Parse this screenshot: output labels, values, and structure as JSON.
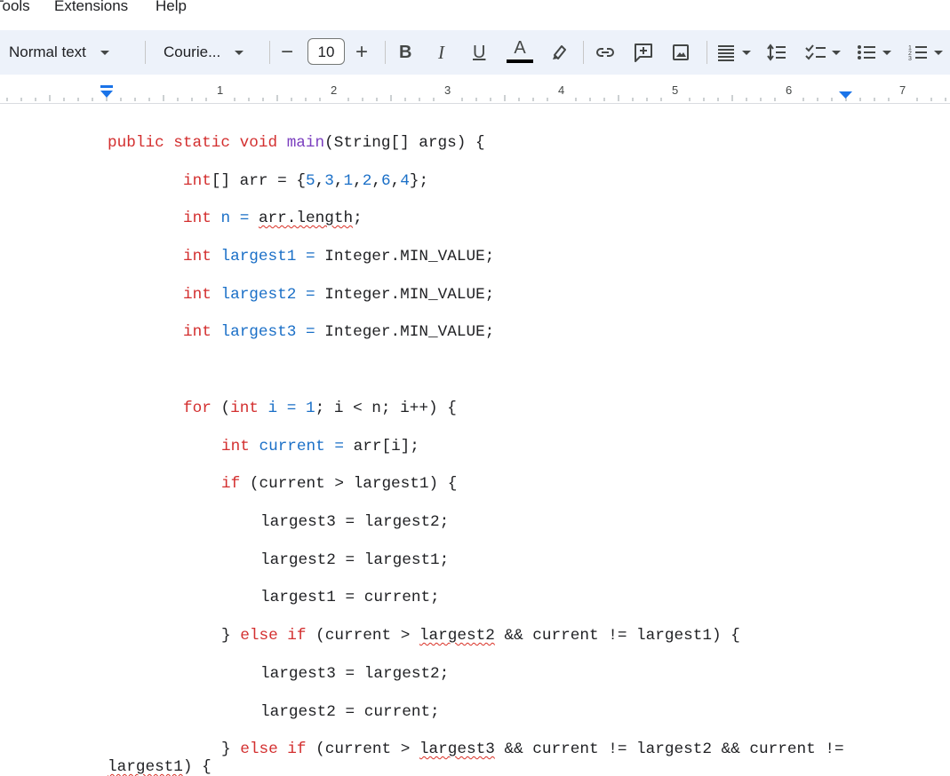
{
  "menu": {
    "tools": "Tools",
    "extensions": "Extensions",
    "help": "Help"
  },
  "toolbar": {
    "style_value": "Normal text",
    "font_value": "Courie...",
    "font_size": "10",
    "decrease_label": "−",
    "increase_label": "+",
    "bold_label": "B",
    "italic_label": "I",
    "underline_label": "U",
    "text_color_label": "A",
    "text_color": "#000000",
    "accent_color": "#1a73e8"
  },
  "ruler": {
    "numbers": [
      "1",
      "2",
      "3",
      "4",
      "5",
      "6",
      "7"
    ]
  },
  "code": {
    "line1": {
      "kw": "public static void",
      "sp1": " ",
      "fn": "main",
      "rest": "(String[] args) {"
    },
    "line2": {
      "kw": "int",
      "t1": "[] arr = {",
      "n1": "5",
      "c1": ",",
      "n2": "3",
      "c2": ",",
      "n3": "1",
      "c3": ",",
      "n4": "2",
      "c4": ",",
      "n5": "6",
      "c5": ",",
      "n6": "4",
      "t2": "};"
    },
    "line3": {
      "kw": "int",
      "sp": " ",
      "var": "n =",
      "sp2": " ",
      "squig": "arr.length",
      "rest": ";"
    },
    "line4": {
      "kw": "int",
      "sp": " ",
      "var": "largest1 =",
      "rest": " Integer.MIN_VALUE;"
    },
    "line5": {
      "kw": "int",
      "sp": " ",
      "var": "largest2 =",
      "rest": " Integer.MIN_VALUE;"
    },
    "line6": {
      "kw": "int",
      "sp": " ",
      "var": "largest3 =",
      "rest": " Integer.MIN_VALUE;"
    },
    "line7": {
      "kw": "for",
      "t1": " (",
      "kw2": "int",
      "sp": " ",
      "var": "i = 1",
      "rest": "; i < n; i++) {"
    },
    "line8": {
      "kw": "int",
      "sp": " ",
      "var": "current =",
      "rest": " arr[i];"
    },
    "line9": {
      "kw": "if",
      "rest": " (current > largest1) {"
    },
    "line10": {
      "text": "largest3 = largest2;"
    },
    "line11": {
      "text": "largest2 = largest1;"
    },
    "line12": {
      "text": "largest1 = current;"
    },
    "line13": {
      "t1": "} ",
      "kw": "else if",
      "t2": " (current > ",
      "squig": "largest2",
      "t3": " && current != largest1) {"
    },
    "line14": {
      "text": "largest3 = largest2;"
    },
    "line15": {
      "text": "largest2 = current;"
    },
    "line16": {
      "t1": "} ",
      "kw": "else if",
      "t2": " (current > ",
      "squig": "largest3",
      "t3": " && current != largest2 && current !="
    },
    "line17": {
      "squig": "largest1",
      "rest": ") {"
    }
  }
}
